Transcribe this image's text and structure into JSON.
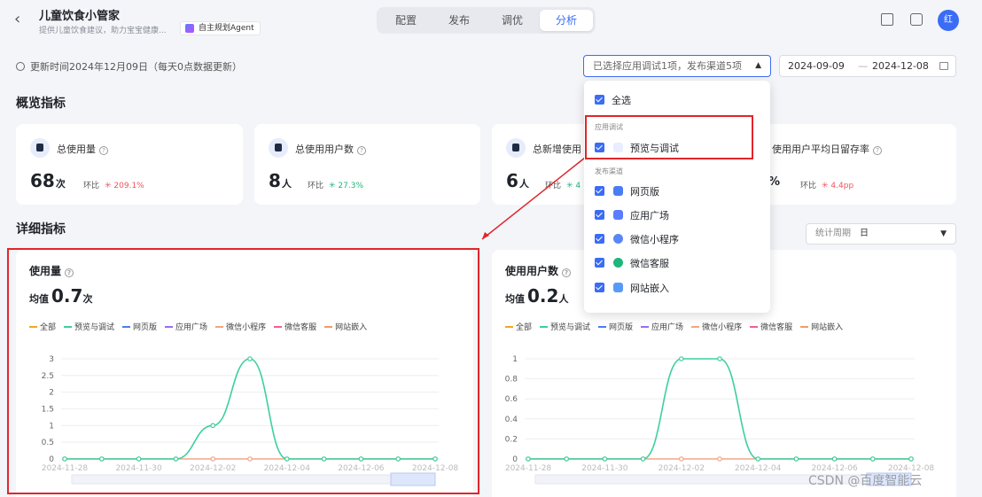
{
  "header": {
    "back_icon": "chevron-left-icon",
    "app_title": "儿童饮食小管家",
    "app_subtitle": "提供儿童饮食建议，助力宝宝健康...",
    "agent_tag": "自主规划Agent",
    "tabs": [
      {
        "label": "配置"
      },
      {
        "label": "发布"
      },
      {
        "label": "调优"
      },
      {
        "label": "分析"
      }
    ],
    "avatar_text": "红"
  },
  "toolbar": {
    "update_text": "更新时间2024年12月09日（每天0点数据更新）",
    "filter_select": "已选择应用调试1项，发布渠道5项",
    "date_start": "2024-09-09",
    "date_sep": "—",
    "date_end": "2024-12-08"
  },
  "overview": {
    "title": "概览指标",
    "cards": [
      {
        "label": "总使用量",
        "value": "68",
        "unit": "次",
        "cmp_label": "环比",
        "cmp_value": "209.1%",
        "trend": "up"
      },
      {
        "label": "总使用用户数",
        "value": "8",
        "unit": "人",
        "cmp_label": "环比",
        "cmp_value": "27.3%",
        "trend": "up"
      },
      {
        "label": "总新增使用",
        "value": "6",
        "unit": "人",
        "cmp_label": "环比",
        "cmp_value": "4",
        "trend": "up"
      },
      {
        "label": "使用用户平均日留存率",
        "value": "%",
        "unit": "",
        "cmp_label": "环比",
        "cmp_value": "4.4pp",
        "trend": "up"
      }
    ]
  },
  "detail": {
    "title": "详细指标",
    "period_label": "统计周期",
    "period_value": "日"
  },
  "dropdown": {
    "select_all": "全选",
    "group1": "应用调试",
    "group1_items": [
      {
        "label": "预览与调试"
      }
    ],
    "group2": "发布渠道",
    "group2_items": [
      {
        "label": "网页版"
      },
      {
        "label": "应用广场"
      },
      {
        "label": "微信小程序"
      },
      {
        "label": "微信客服"
      },
      {
        "label": "网站嵌入"
      }
    ]
  },
  "legend": [
    {
      "name": "全部",
      "color": "#f5a623"
    },
    {
      "name": "预览与调试",
      "color": "#3ccf9f"
    },
    {
      "name": "网页版",
      "color": "#4a7cf6"
    },
    {
      "name": "应用广场",
      "color": "#9b6cf3"
    },
    {
      "name": "微信小程序",
      "color": "#f2a583"
    },
    {
      "name": "微信客服",
      "color": "#f25f8a"
    },
    {
      "name": "网站嵌入",
      "color": "#f39a6b"
    }
  ],
  "chart_data": [
    {
      "type": "line",
      "title": "使用量",
      "avg_label": "均值",
      "avg_value": "0.7",
      "avg_unit": "次",
      "x": [
        "2024-11-28",
        "2024-11-29",
        "2024-11-30",
        "2024-12-01",
        "2024-12-02",
        "2024-12-03",
        "2024-12-04",
        "2024-12-05",
        "2024-12-06",
        "2024-12-07",
        "2024-12-08"
      ],
      "x_tick_labels": [
        "2024-11-28",
        "2024-11-30",
        "2024-12-02",
        "2024-12-04",
        "2024-12-06",
        "2024-12-08"
      ],
      "yticks": [
        "0",
        "0.5",
        "1",
        "1.5",
        "2",
        "2.5",
        "3"
      ],
      "ylim": [
        0,
        3
      ],
      "series": [
        {
          "name": "预览与调试",
          "values": [
            0,
            0,
            0,
            0,
            1,
            3,
            0,
            0,
            0,
            0,
            0
          ]
        },
        {
          "name": "微信小程序",
          "values": [
            0,
            0,
            0,
            0,
            0,
            0,
            0,
            0,
            0,
            0,
            0
          ]
        }
      ]
    },
    {
      "type": "line",
      "title": "使用用户数",
      "avg_label": "均值",
      "avg_value": "0.2",
      "avg_unit": "人",
      "x": [
        "2024-11-28",
        "2024-11-29",
        "2024-11-30",
        "2024-12-01",
        "2024-12-02",
        "2024-12-03",
        "2024-12-04",
        "2024-12-05",
        "2024-12-06",
        "2024-12-07",
        "2024-12-08"
      ],
      "x_tick_labels": [
        "2024-11-28",
        "2024-11-30",
        "2024-12-02",
        "2024-12-04",
        "2024-12-06",
        "2024-12-08"
      ],
      "yticks": [
        "0",
        "0.2",
        "0.4",
        "0.6",
        "0.8",
        "1"
      ],
      "ylim": [
        0,
        1
      ],
      "series": [
        {
          "name": "预览与调试",
          "values": [
            0,
            0,
            0,
            0,
            1,
            1,
            0,
            0,
            0,
            0,
            0
          ]
        },
        {
          "name": "微信小程序",
          "values": [
            0,
            0,
            0,
            0,
            0,
            0,
            0,
            0,
            0,
            0,
            0
          ]
        }
      ]
    }
  ],
  "watermark": "CSDN @百度智能云"
}
